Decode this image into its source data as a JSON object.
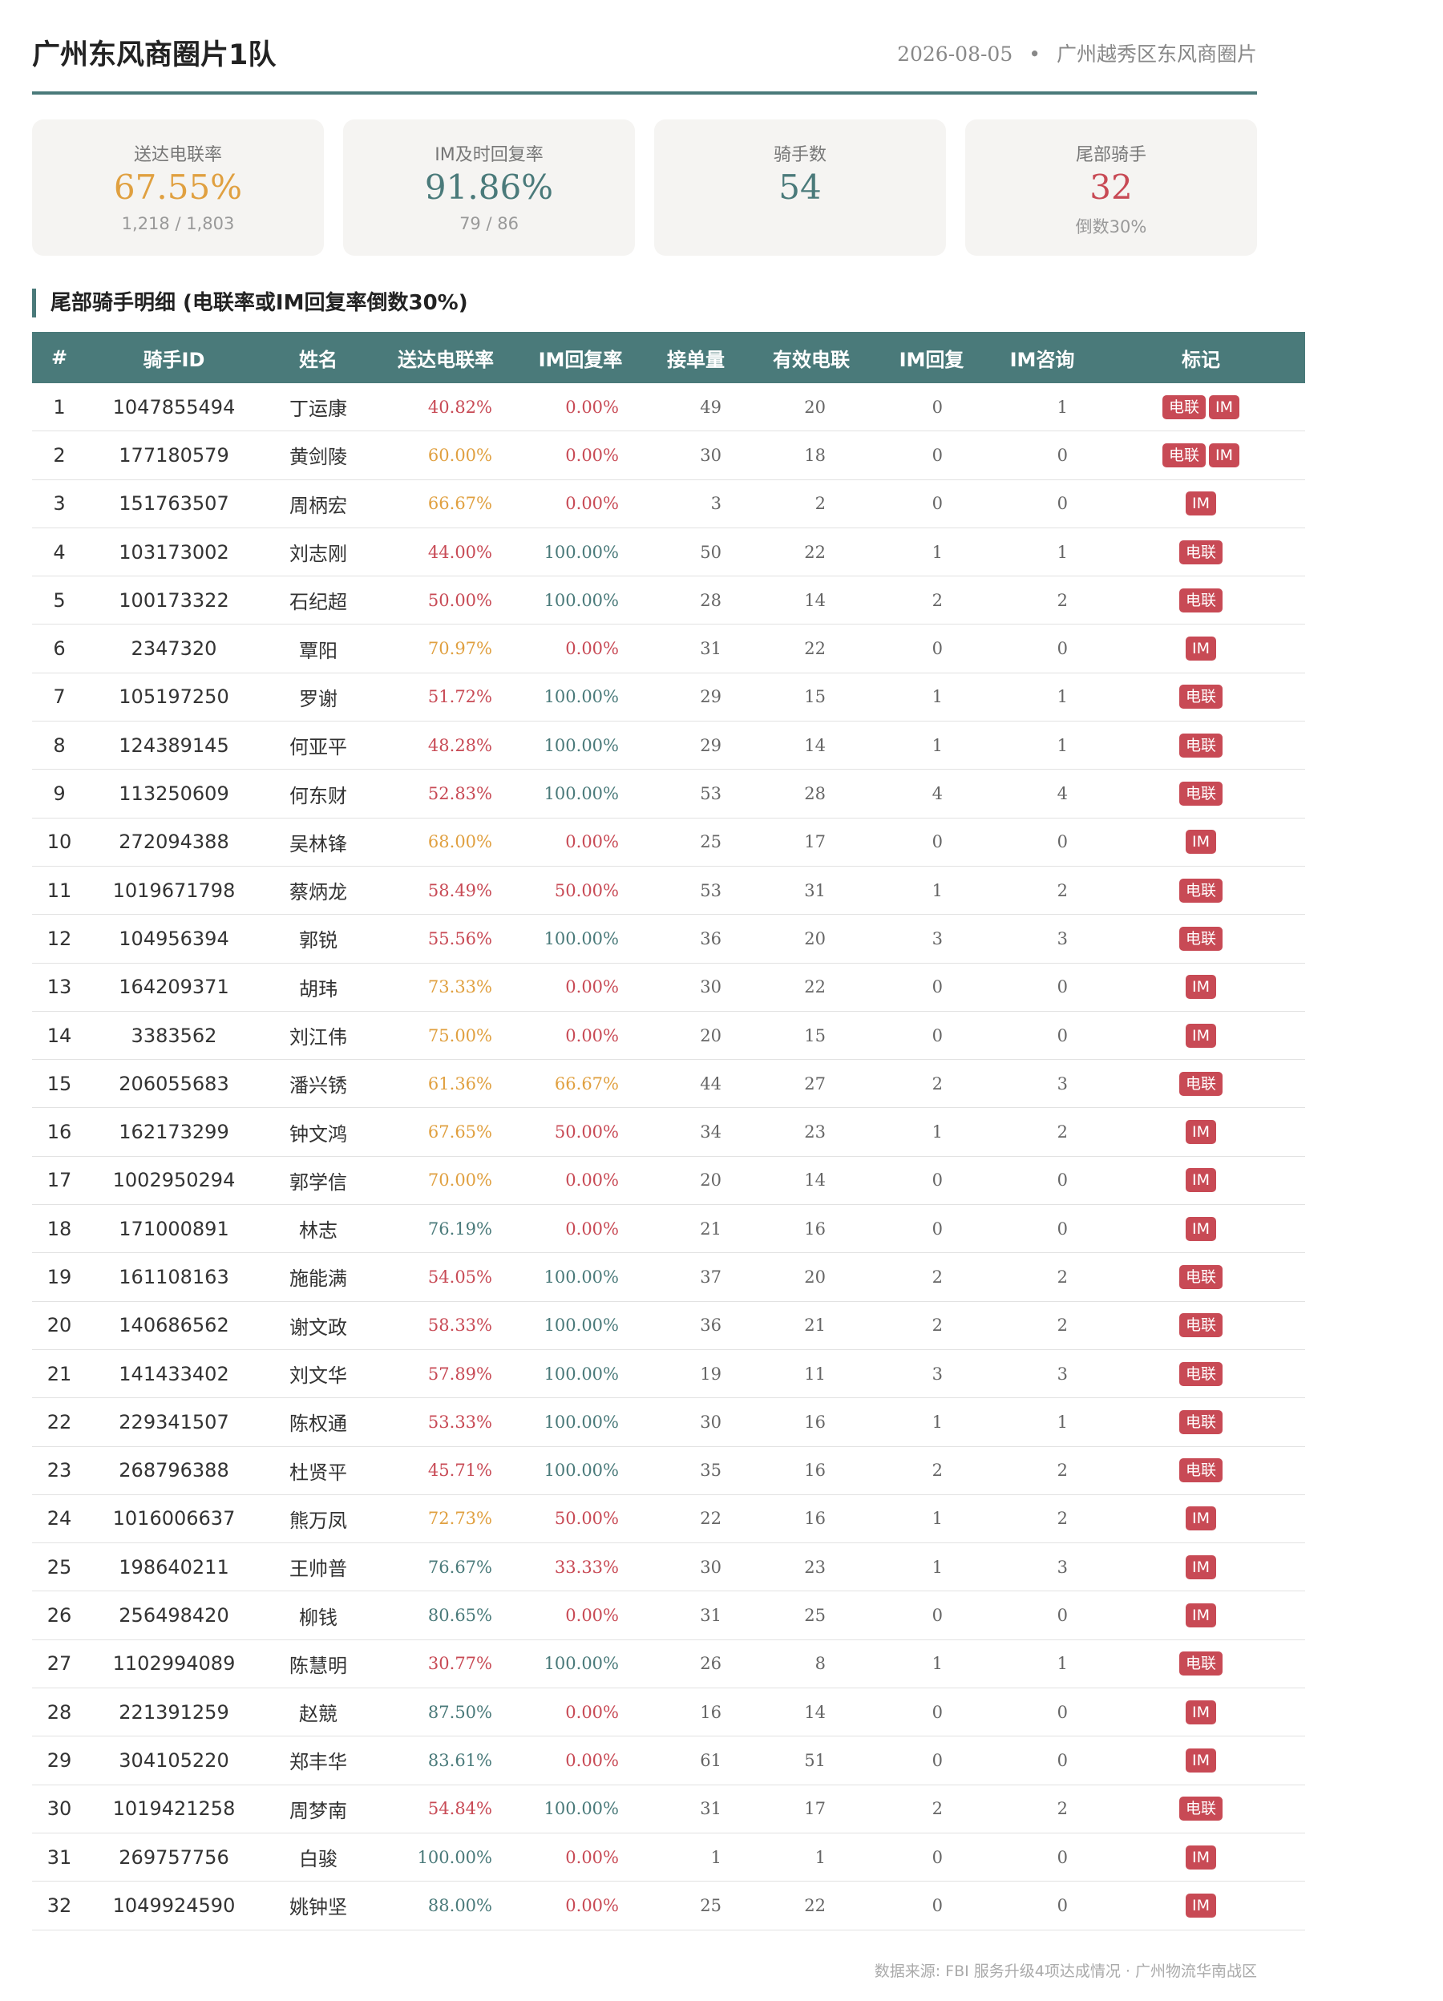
{
  "header": {
    "title": "广州东风商圈片1队",
    "date": "2026-08-05",
    "separator": "•",
    "region": "广州越秀区东风商圈片"
  },
  "cards": [
    {
      "label": "送达电联率",
      "value": "67.55%",
      "sub": "1,218 / 1,803",
      "color": "#e0a040"
    },
    {
      "label": "IM及时回复率",
      "value": "91.86%",
      "sub": "79 / 86",
      "color": "#4a7a7a"
    },
    {
      "label": "骑手数",
      "value": "54",
      "sub": "",
      "color": "#4a7a7a"
    },
    {
      "label": "尾部骑手",
      "value": "32",
      "sub": "倒数30%",
      "color": "#c84a55"
    }
  ],
  "section_title": "尾部骑手明细 (电联率或IM回复率倒数30%)",
  "colors": {
    "red": "#c84a55",
    "orange": "#e0a040",
    "teal": "#4a7a7a"
  },
  "table": {
    "headers": [
      "#",
      "骑手ID",
      "姓名",
      "送达电联率",
      "IM回复率",
      "接单量",
      "有效电联",
      "IM回复",
      "IM咨询",
      "标记"
    ],
    "rows": [
      {
        "idx": "1",
        "id": "1047855494",
        "name": "丁运康",
        "call": "40.82%",
        "call_c": "red",
        "im": "0.00%",
        "im_c": "red",
        "orders": "49",
        "valid": "20",
        "imr": "0",
        "imq": "1",
        "tags": [
          "电联",
          "IM"
        ]
      },
      {
        "idx": "2",
        "id": "177180579",
        "name": "黄剑陵",
        "call": "60.00%",
        "call_c": "orange",
        "im": "0.00%",
        "im_c": "red",
        "orders": "30",
        "valid": "18",
        "imr": "0",
        "imq": "0",
        "tags": [
          "电联",
          "IM"
        ]
      },
      {
        "idx": "3",
        "id": "151763507",
        "name": "周柄宏",
        "call": "66.67%",
        "call_c": "orange",
        "im": "0.00%",
        "im_c": "red",
        "orders": "3",
        "valid": "2",
        "imr": "0",
        "imq": "0",
        "tags": [
          "IM"
        ]
      },
      {
        "idx": "4",
        "id": "103173002",
        "name": "刘志刚",
        "call": "44.00%",
        "call_c": "red",
        "im": "100.00%",
        "im_c": "teal",
        "orders": "50",
        "valid": "22",
        "imr": "1",
        "imq": "1",
        "tags": [
          "电联"
        ]
      },
      {
        "idx": "5",
        "id": "100173322",
        "name": "石纪超",
        "call": "50.00%",
        "call_c": "red",
        "im": "100.00%",
        "im_c": "teal",
        "orders": "28",
        "valid": "14",
        "imr": "2",
        "imq": "2",
        "tags": [
          "电联"
        ]
      },
      {
        "idx": "6",
        "id": "2347320",
        "name": "覃阳",
        "call": "70.97%",
        "call_c": "orange",
        "im": "0.00%",
        "im_c": "red",
        "orders": "31",
        "valid": "22",
        "imr": "0",
        "imq": "0",
        "tags": [
          "IM"
        ]
      },
      {
        "idx": "7",
        "id": "105197250",
        "name": "罗谢",
        "call": "51.72%",
        "call_c": "red",
        "im": "100.00%",
        "im_c": "teal",
        "orders": "29",
        "valid": "15",
        "imr": "1",
        "imq": "1",
        "tags": [
          "电联"
        ]
      },
      {
        "idx": "8",
        "id": "124389145",
        "name": "何亚平",
        "call": "48.28%",
        "call_c": "red",
        "im": "100.00%",
        "im_c": "teal",
        "orders": "29",
        "valid": "14",
        "imr": "1",
        "imq": "1",
        "tags": [
          "电联"
        ]
      },
      {
        "idx": "9",
        "id": "113250609",
        "name": "何东财",
        "call": "52.83%",
        "call_c": "red",
        "im": "100.00%",
        "im_c": "teal",
        "orders": "53",
        "valid": "28",
        "imr": "4",
        "imq": "4",
        "tags": [
          "电联"
        ]
      },
      {
        "idx": "10",
        "id": "272094388",
        "name": "吴林锋",
        "call": "68.00%",
        "call_c": "orange",
        "im": "0.00%",
        "im_c": "red",
        "orders": "25",
        "valid": "17",
        "imr": "0",
        "imq": "0",
        "tags": [
          "IM"
        ]
      },
      {
        "idx": "11",
        "id": "1019671798",
        "name": "蔡炳龙",
        "call": "58.49%",
        "call_c": "red",
        "im": "50.00%",
        "im_c": "red",
        "orders": "53",
        "valid": "31",
        "imr": "1",
        "imq": "2",
        "tags": [
          "电联"
        ]
      },
      {
        "idx": "12",
        "id": "104956394",
        "name": "郭锐",
        "call": "55.56%",
        "call_c": "red",
        "im": "100.00%",
        "im_c": "teal",
        "orders": "36",
        "valid": "20",
        "imr": "3",
        "imq": "3",
        "tags": [
          "电联"
        ]
      },
      {
        "idx": "13",
        "id": "164209371",
        "name": "胡玮",
        "call": "73.33%",
        "call_c": "orange",
        "im": "0.00%",
        "im_c": "red",
        "orders": "30",
        "valid": "22",
        "imr": "0",
        "imq": "0",
        "tags": [
          "IM"
        ]
      },
      {
        "idx": "14",
        "id": "3383562",
        "name": "刘江伟",
        "call": "75.00%",
        "call_c": "orange",
        "im": "0.00%",
        "im_c": "red",
        "orders": "20",
        "valid": "15",
        "imr": "0",
        "imq": "0",
        "tags": [
          "IM"
        ]
      },
      {
        "idx": "15",
        "id": "206055683",
        "name": "潘兴锈",
        "call": "61.36%",
        "call_c": "orange",
        "im": "66.67%",
        "im_c": "orange",
        "orders": "44",
        "valid": "27",
        "imr": "2",
        "imq": "3",
        "tags": [
          "电联"
        ]
      },
      {
        "idx": "16",
        "id": "162173299",
        "name": "钟文鸿",
        "call": "67.65%",
        "call_c": "orange",
        "im": "50.00%",
        "im_c": "red",
        "orders": "34",
        "valid": "23",
        "imr": "1",
        "imq": "2",
        "tags": [
          "IM"
        ]
      },
      {
        "idx": "17",
        "id": "1002950294",
        "name": "郭学信",
        "call": "70.00%",
        "call_c": "orange",
        "im": "0.00%",
        "im_c": "red",
        "orders": "20",
        "valid": "14",
        "imr": "0",
        "imq": "0",
        "tags": [
          "IM"
        ]
      },
      {
        "idx": "18",
        "id": "171000891",
        "name": "林志",
        "call": "76.19%",
        "call_c": "teal",
        "im": "0.00%",
        "im_c": "red",
        "orders": "21",
        "valid": "16",
        "imr": "0",
        "imq": "0",
        "tags": [
          "IM"
        ]
      },
      {
        "idx": "19",
        "id": "161108163",
        "name": "施能满",
        "call": "54.05%",
        "call_c": "red",
        "im": "100.00%",
        "im_c": "teal",
        "orders": "37",
        "valid": "20",
        "imr": "2",
        "imq": "2",
        "tags": [
          "电联"
        ]
      },
      {
        "idx": "20",
        "id": "140686562",
        "name": "谢文政",
        "call": "58.33%",
        "call_c": "red",
        "im": "100.00%",
        "im_c": "teal",
        "orders": "36",
        "valid": "21",
        "imr": "2",
        "imq": "2",
        "tags": [
          "电联"
        ]
      },
      {
        "idx": "21",
        "id": "141433402",
        "name": "刘文华",
        "call": "57.89%",
        "call_c": "red",
        "im": "100.00%",
        "im_c": "teal",
        "orders": "19",
        "valid": "11",
        "imr": "3",
        "imq": "3",
        "tags": [
          "电联"
        ]
      },
      {
        "idx": "22",
        "id": "229341507",
        "name": "陈权通",
        "call": "53.33%",
        "call_c": "red",
        "im": "100.00%",
        "im_c": "teal",
        "orders": "30",
        "valid": "16",
        "imr": "1",
        "imq": "1",
        "tags": [
          "电联"
        ]
      },
      {
        "idx": "23",
        "id": "268796388",
        "name": "杜贤平",
        "call": "45.71%",
        "call_c": "red",
        "im": "100.00%",
        "im_c": "teal",
        "orders": "35",
        "valid": "16",
        "imr": "2",
        "imq": "2",
        "tags": [
          "电联"
        ]
      },
      {
        "idx": "24",
        "id": "1016006637",
        "name": "熊万凤",
        "call": "72.73%",
        "call_c": "orange",
        "im": "50.00%",
        "im_c": "red",
        "orders": "22",
        "valid": "16",
        "imr": "1",
        "imq": "2",
        "tags": [
          "IM"
        ]
      },
      {
        "idx": "25",
        "id": "198640211",
        "name": "王帅普",
        "call": "76.67%",
        "call_c": "teal",
        "im": "33.33%",
        "im_c": "red",
        "orders": "30",
        "valid": "23",
        "imr": "1",
        "imq": "3",
        "tags": [
          "IM"
        ]
      },
      {
        "idx": "26",
        "id": "256498420",
        "name": "柳钱",
        "call": "80.65%",
        "call_c": "teal",
        "im": "0.00%",
        "im_c": "red",
        "orders": "31",
        "valid": "25",
        "imr": "0",
        "imq": "0",
        "tags": [
          "IM"
        ]
      },
      {
        "idx": "27",
        "id": "1102994089",
        "name": "陈慧明",
        "call": "30.77%",
        "call_c": "red",
        "im": "100.00%",
        "im_c": "teal",
        "orders": "26",
        "valid": "8",
        "imr": "1",
        "imq": "1",
        "tags": [
          "电联"
        ]
      },
      {
        "idx": "28",
        "id": "221391259",
        "name": "赵競",
        "call": "87.50%",
        "call_c": "teal",
        "im": "0.00%",
        "im_c": "red",
        "orders": "16",
        "valid": "14",
        "imr": "0",
        "imq": "0",
        "tags": [
          "IM"
        ]
      },
      {
        "idx": "29",
        "id": "304105220",
        "name": "郑丰华",
        "call": "83.61%",
        "call_c": "teal",
        "im": "0.00%",
        "im_c": "red",
        "orders": "61",
        "valid": "51",
        "imr": "0",
        "imq": "0",
        "tags": [
          "IM"
        ]
      },
      {
        "idx": "30",
        "id": "1019421258",
        "name": "周梦南",
        "call": "54.84%",
        "call_c": "red",
        "im": "100.00%",
        "im_c": "teal",
        "orders": "31",
        "valid": "17",
        "imr": "2",
        "imq": "2",
        "tags": [
          "电联"
        ]
      },
      {
        "idx": "31",
        "id": "269757756",
        "name": "白骏",
        "call": "100.00%",
        "call_c": "teal",
        "im": "0.00%",
        "im_c": "red",
        "orders": "1",
        "valid": "1",
        "imr": "0",
        "imq": "0",
        "tags": [
          "IM"
        ]
      },
      {
        "idx": "32",
        "id": "1049924590",
        "name": "姚钟坚",
        "call": "88.00%",
        "call_c": "teal",
        "im": "0.00%",
        "im_c": "red",
        "orders": "25",
        "valid": "22",
        "imr": "0",
        "imq": "0",
        "tags": [
          "IM"
        ]
      }
    ]
  },
  "footer": "数据来源: FBI 服务升级4项达成情况 · 广州物流华南战区"
}
